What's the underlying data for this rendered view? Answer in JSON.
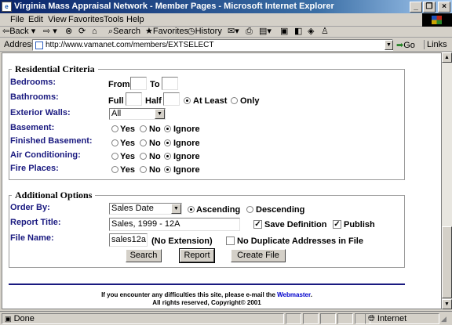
{
  "window": {
    "title": "Virginia Mass Appraisal Network - Member Pages - Microsoft Internet Explorer"
  },
  "menu": {
    "items": [
      "File",
      "Edit",
      "View",
      "Favorites",
      "Tools",
      "Help"
    ]
  },
  "toolbar": {
    "back": "Back",
    "search": "Search",
    "favorites": "Favorites",
    "history": "History"
  },
  "address": {
    "label": "Address",
    "url": "http://www.vamanet.com/members/EXTSELECT",
    "go": "Go",
    "links": "Links"
  },
  "residential": {
    "legend": "Residential Criteria",
    "bedrooms": {
      "label": "Bedrooms:",
      "from": "From",
      "to": "To"
    },
    "bathrooms": {
      "label": "Bathrooms:",
      "full": "Full",
      "half": "Half",
      "at_least": "At Least",
      "only": "Only"
    },
    "exterior_walls": {
      "label": "Exterior Walls:",
      "value": "All"
    },
    "basement": {
      "label": "Basement:"
    },
    "finished_basement": {
      "label": "Finished Basement:"
    },
    "air_conditioning": {
      "label": "Air Conditioning:"
    },
    "fire_places": {
      "label": "Fire Places:"
    },
    "opt_yes": "Yes",
    "opt_no": "No",
    "opt_ignore": "Ignore"
  },
  "additional": {
    "legend": "Additional Options",
    "order_by": {
      "label": "Order By:",
      "value": "Sales Date",
      "ascending": "Ascending",
      "descending": "Descending"
    },
    "report_title": {
      "label": "Report Title:",
      "value": "Sales, 1999 - 12A",
      "save_definition": "Save Definition",
      "publish": "Publish"
    },
    "file_name": {
      "label": "File Name:",
      "value": "sales12a",
      "no_extension": "(No Extension)",
      "no_duplicates": "No Duplicate Addresses in File"
    },
    "buttons": {
      "search": "Search",
      "report": "Report",
      "create_file": "Create File"
    }
  },
  "footer": {
    "line1": "If you encounter any difficulties this site, please e-mail the",
    "link": "Webmaster",
    "period": ".",
    "line2": "All rights reserved, Copyright© 2001"
  },
  "status": {
    "text": "Done",
    "zone": "Internet"
  },
  "colors": {
    "title_start": "#0a246a",
    "label_blue": "#1a1a80",
    "link_blue": "#0000cc",
    "rule": "#1a1a80"
  }
}
